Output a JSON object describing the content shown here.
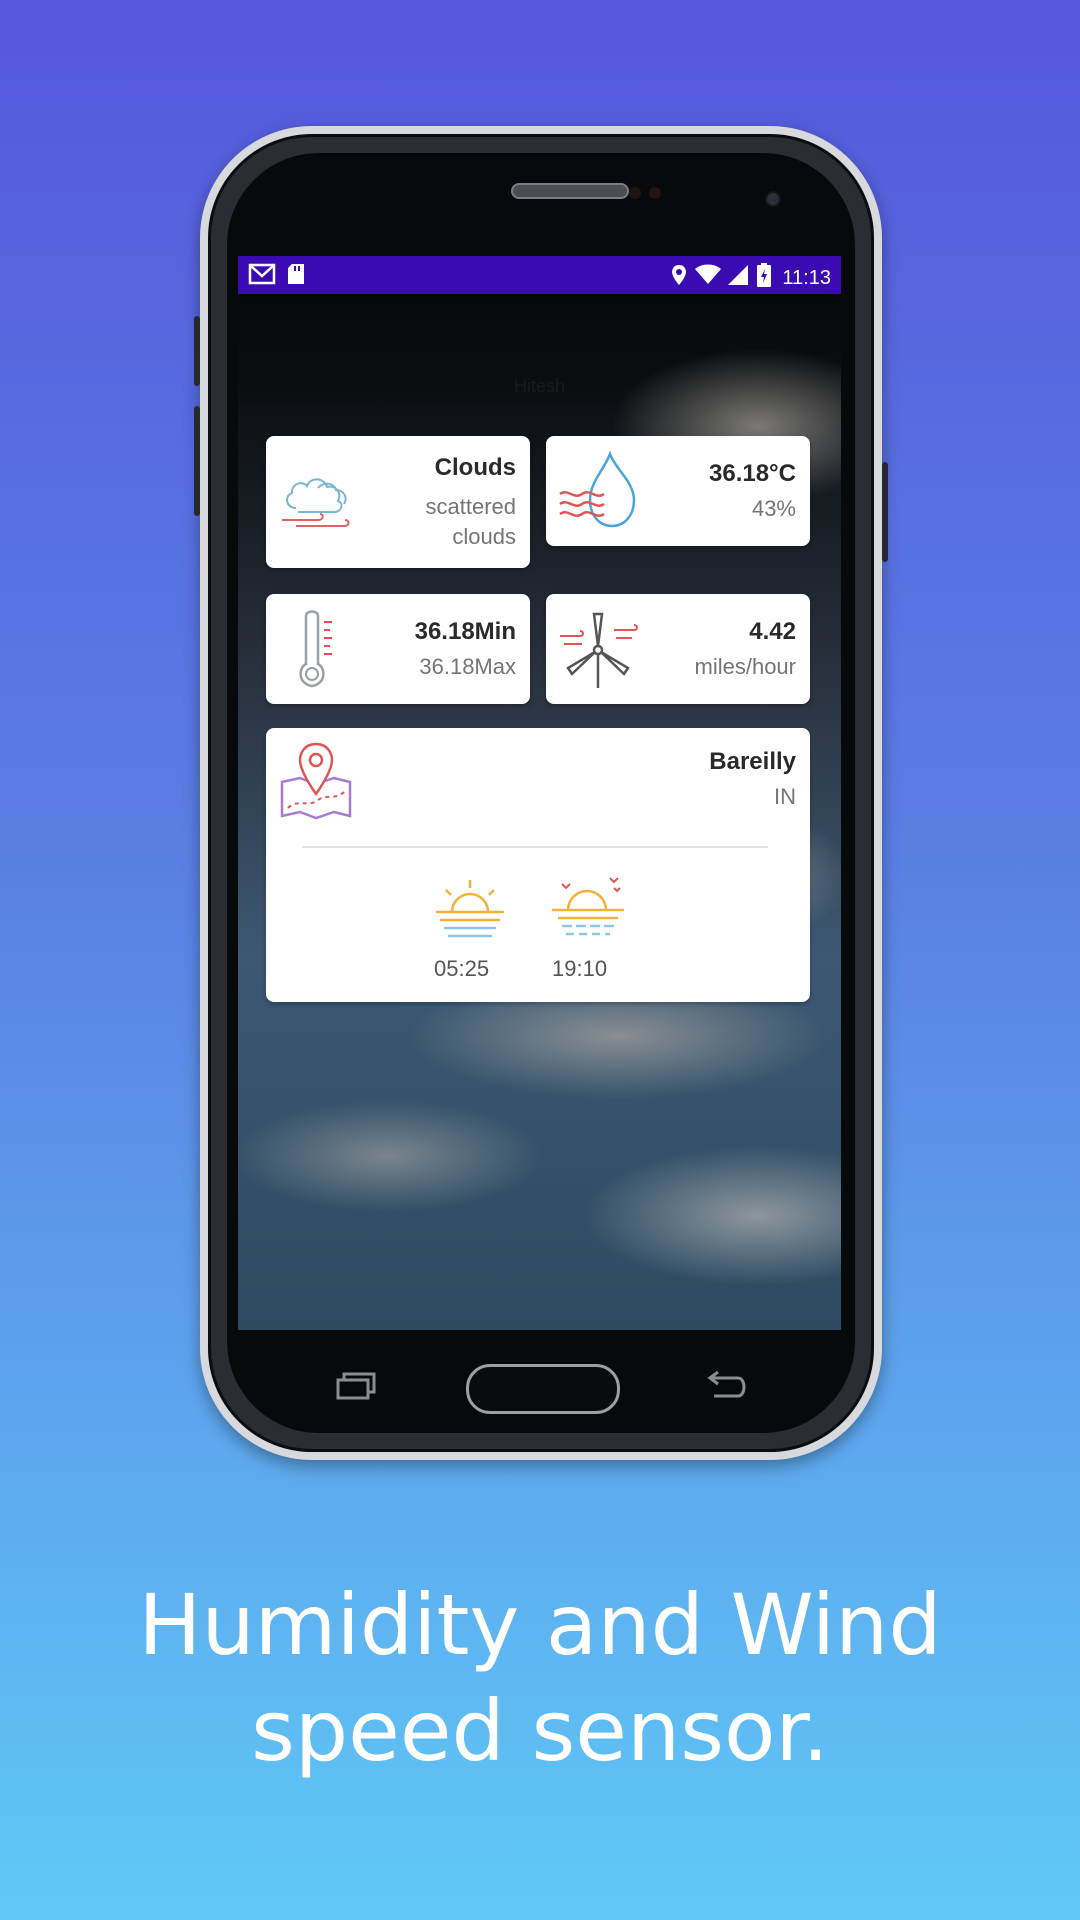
{
  "status_bar": {
    "time": "11:13",
    "left_icons": [
      "gmail-icon",
      "sd-card-icon"
    ],
    "right_icons": [
      "location-icon",
      "wifi-icon",
      "signal-icon",
      "battery-charging-icon"
    ]
  },
  "header_hint": "Hitesh",
  "cards": {
    "weather": {
      "main": "Clouds",
      "desc_line1": "scattered",
      "desc_line2": "clouds",
      "icon": "cloud-wind-icon"
    },
    "humidity": {
      "temp": "36.18°C",
      "humidity": "43%",
      "icon": "water-drop-icon"
    },
    "temperature": {
      "min": "36.18Min",
      "max": "36.18Max",
      "icon": "thermometer-icon"
    },
    "wind": {
      "speed": "4.42",
      "unit": "miles/hour",
      "icon": "wind-turbine-icon"
    },
    "location": {
      "city": "Bareilly",
      "country": "IN",
      "sunrise": "05:25",
      "sunset": "19:10",
      "icon": "map-pin-icon"
    }
  },
  "nav": {
    "buttons": [
      "recent-apps-button",
      "home-button",
      "back-button"
    ]
  },
  "caption": {
    "line1": "Humidity and Wind",
    "line2": "speed sensor."
  },
  "colors": {
    "background_top": "#5558dc",
    "background_bottom": "#5fc9f6",
    "status_bar": "#3a0bb2",
    "card": "#ffffff"
  }
}
